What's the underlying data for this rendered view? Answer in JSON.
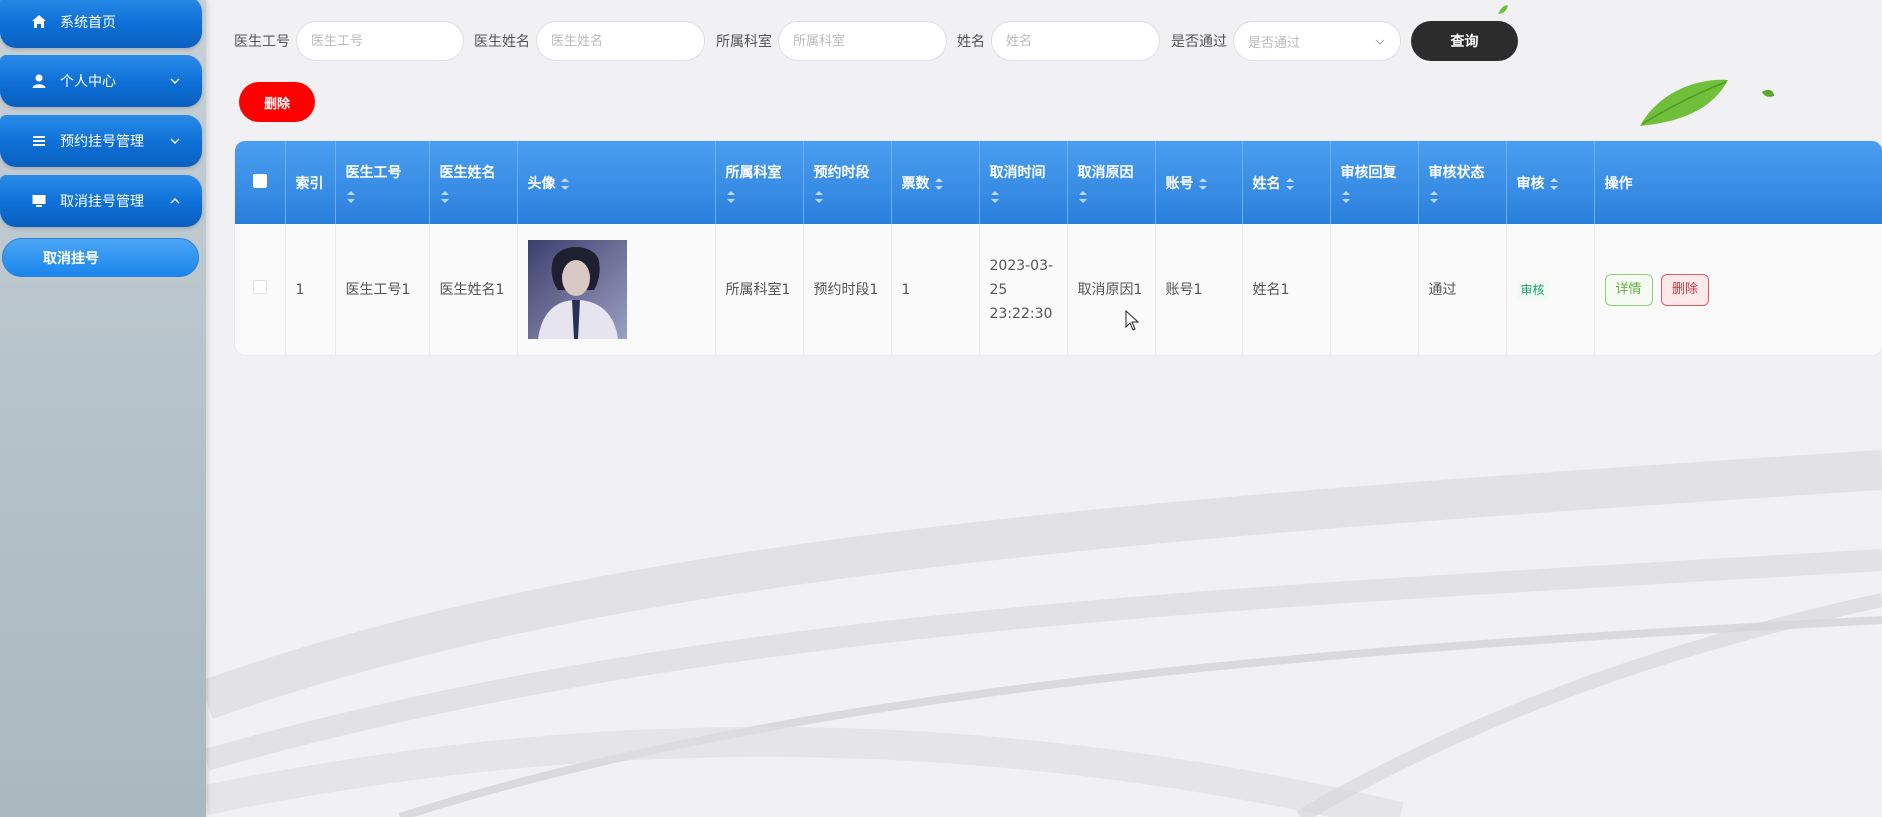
{
  "sidebar": {
    "items": [
      {
        "label": "系统首页",
        "icon": "home-icon"
      },
      {
        "label": "个人中心",
        "icon": "user-icon"
      },
      {
        "label": "预约挂号管理",
        "icon": "list-icon"
      },
      {
        "label": "取消挂号管理",
        "icon": "monitor-icon"
      }
    ],
    "submenu": {
      "label": "取消挂号"
    }
  },
  "search": {
    "doctor_id_label": "医生工号",
    "doctor_id_placeholder": "医生工号",
    "doctor_name_label": "医生姓名",
    "doctor_name_placeholder": "医生姓名",
    "department_label": "所属科室",
    "department_placeholder": "所属科室",
    "name_label": "姓名",
    "name_placeholder": "姓名",
    "passed_label": "是否通过",
    "passed_placeholder": "是否通过",
    "query_label": "查询"
  },
  "toolbar": {
    "delete_label": "删除"
  },
  "table": {
    "headers": {
      "index": "索引",
      "doctor_id": "医生工号",
      "doctor_name": "医生姓名",
      "avatar": "头像",
      "department": "所属科室",
      "slot": "预约时段",
      "tickets": "票数",
      "cancel_time": "取消时间",
      "cancel_reason": "取消原因",
      "account": "账号",
      "name": "姓名",
      "reply": "审核回复",
      "status": "审核状态",
      "audit": "审核",
      "actions": "操作"
    },
    "rows": [
      {
        "index": "1",
        "doctor_id": "医生工号1",
        "doctor_name": "医生姓名1",
        "department": "所属科室1",
        "slot": "预约时段1",
        "tickets": "1",
        "cancel_time": "2023-03-25 23:22:30",
        "cancel_reason": "取消原因1",
        "account": "账号1",
        "name": "姓名1",
        "reply": "",
        "status": "通过",
        "audit": "审核",
        "detail_label": "详情",
        "delete_label": "删除"
      }
    ]
  },
  "colors": {
    "primary": "#1a86ec",
    "danger": "#ff0000",
    "query_button": "#2c2c2c",
    "header_blue": "#3a8fe6"
  }
}
